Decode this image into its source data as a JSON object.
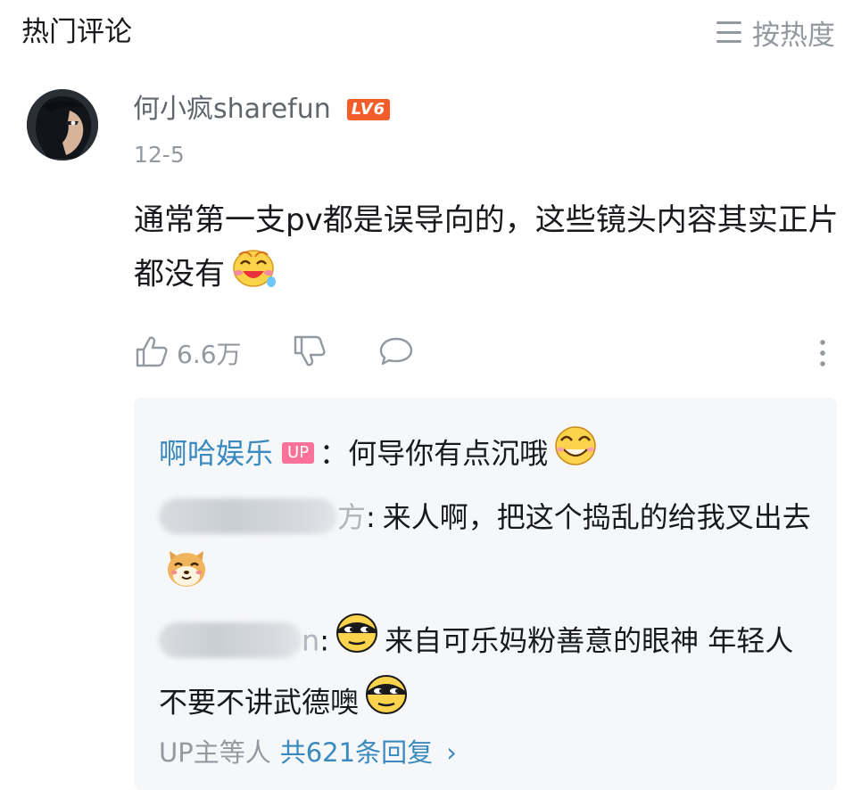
{
  "header": {
    "title": "热门评论",
    "sort_label": "按热度"
  },
  "comment": {
    "username": "何小疯sharefun",
    "level": "LV6",
    "date": "12-5",
    "text": "通常第一支pv都是误导向的，这些镜头内容其实正片都没有",
    "likes": "6.6万"
  },
  "replies": {
    "items": [
      {
        "user": "啊哈娱乐",
        "badge": "UP",
        "sep": "：",
        "text": "何导你有点沉哦"
      },
      {
        "user_visible_tail": "方",
        "sep": ":",
        "text": "来人啊，把这个捣乱的给我叉出去"
      },
      {
        "user_visible_tail": "n",
        "sep": ":",
        "text": "来自可乐妈粉善意的眼神 年轻人不要不讲武德噢"
      }
    ],
    "summary_prefix": "UP主等人",
    "summary_link": "共621条回复",
    "summary_chevron": "›"
  },
  "colors": {
    "link_blue": "#3a8ac0",
    "level_badge": "#f25d2a",
    "up_badge": "#fb7299",
    "muted": "#9499a0",
    "reply_bg": "#f6f7f8"
  }
}
